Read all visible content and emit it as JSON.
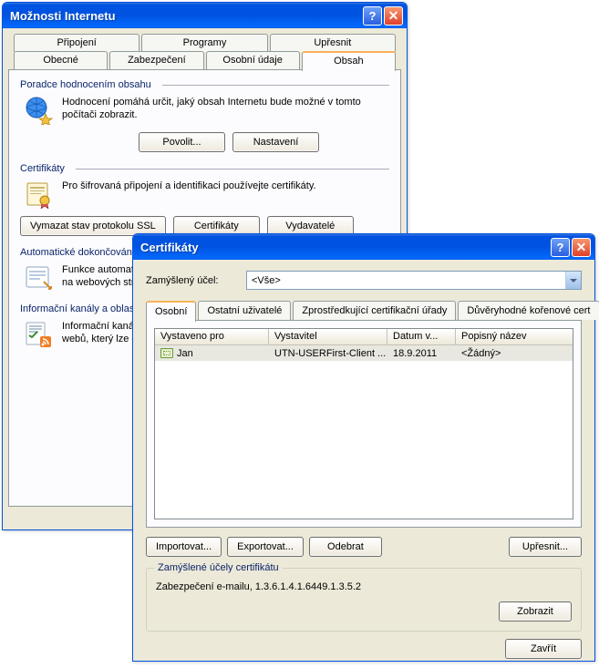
{
  "internetOptions": {
    "title": "Možnosti Internetu",
    "tabsTop": [
      "Připojení",
      "Programy",
      "Upřesnit"
    ],
    "tabsBottom": [
      "Obecné",
      "Zabezpečení",
      "Osobní údaje",
      "Obsah"
    ],
    "selectedTab": "Obsah",
    "sections": {
      "advisor": {
        "title": "Poradce hodnocením obsahu",
        "text": "Hodnocení pomáhá určit, jaký obsah Internetu bude možné v tomto počítači zobrazit.",
        "btnEnable": "Povolit...",
        "btnSettings": "Nastavení"
      },
      "certs": {
        "title": "Certifikáty",
        "text": "Pro šifrovaná připojení a identifikaci používejte certifikáty.",
        "btnClearSSL": "Vymazat stav protokolu SSL",
        "btnCertificates": "Certifikáty",
        "btnPublishers": "Vydavatelé"
      },
      "auto": {
        "title": "Automatické dokončování",
        "text": "Funkce automatického dokončování uchovává předchozí položky zadané na webových stránkách a navrhne odpovídající položky."
      },
      "feeds": {
        "title": "Informační kanály a oblasti Web Slice",
        "text": "Informační kanály a oblasti Web Slice poskytují aktualizovaný obsah webů, který lze číst v aplikacích Internet Explorer a dalších programech."
      }
    }
  },
  "certDialog": {
    "title": "Certifikáty",
    "purposeLabel": "Zamýšlený účel:",
    "purposeValue": "<Vše>",
    "tabs": [
      "Osobní",
      "Ostatní uživatelé",
      "Zprostředkující certifikační úřady",
      "Důvěryhodné kořenové cert"
    ],
    "columns": {
      "issuedTo": "Vystaveno pro",
      "issuer": "Vystavitel",
      "expires": "Datum v...",
      "friendly": "Popisný název"
    },
    "row": {
      "issuedTo": "Jan",
      "issuer": "UTN-USERFirst-Client ...",
      "expires": "18.9.2011",
      "friendly": "<Žádný>"
    },
    "btnImport": "Importovat...",
    "btnExport": "Exportovat...",
    "btnRemove": "Odebrat",
    "btnAdvanced": "Upřesnit...",
    "group": {
      "title": "Zamýšlené účely certifikátu",
      "body": "Zabezpečení e-mailu, 1.3.6.1.4.1.6449.1.3.5.2",
      "btnView": "Zobrazit"
    },
    "btnClose": "Zavřít"
  }
}
